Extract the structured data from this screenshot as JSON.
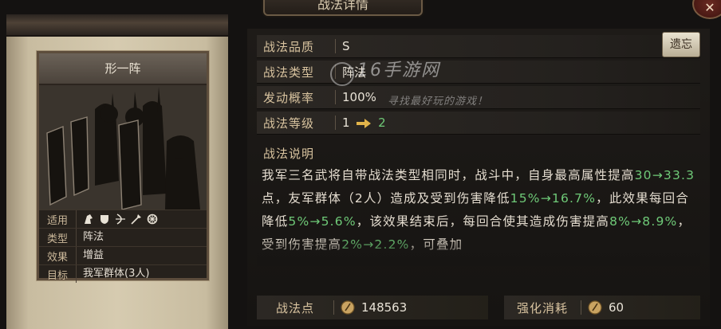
{
  "window": {
    "title": "战法详情",
    "close_label": "✕"
  },
  "card": {
    "name": "形一阵",
    "rows": [
      {
        "key": "适用",
        "type": "weapons",
        "icons": [
          "cavalry-icon",
          "shield-icon",
          "bow-icon",
          "spear-icon",
          "wheel-icon"
        ]
      },
      {
        "key": "类型",
        "value": "阵法"
      },
      {
        "key": "效果",
        "value": "增益"
      },
      {
        "key": "目标",
        "value": "我军群体(3人)"
      }
    ]
  },
  "details": {
    "quality_label": "战法品质",
    "quality_value": "S",
    "type_label": "战法类型",
    "type_value": "阵法",
    "trigger_label": "发动概率",
    "trigger_value": "100%",
    "level_label": "战法等级",
    "level_from": "1",
    "level_to": "2",
    "recall_button": "遗忘"
  },
  "description": {
    "heading": "战法说明",
    "segments": [
      {
        "t": "我军三名武将自带战法类型相同时，战斗中，自身最高属性提高",
        "c": "n"
      },
      {
        "t": "30→33.3",
        "c": "g"
      },
      {
        "t": "点，友军群体（2人）造成及受到伤害降低",
        "c": "n"
      },
      {
        "t": "15%→16.7%",
        "c": "g"
      },
      {
        "t": "，此效果每回合降低",
        "c": "n"
      },
      {
        "t": "5%→5.6%",
        "c": "g"
      },
      {
        "t": "，该效果结束后，每回合使其造成伤害提高",
        "c": "n"
      },
      {
        "t": "8%→8.9%",
        "c": "g"
      },
      {
        "t": "，受到伤害提高",
        "c": "n"
      },
      {
        "t": "2%→2.2%",
        "c": "g"
      },
      {
        "t": "，可叠加",
        "c": "n"
      }
    ]
  },
  "footer": {
    "points_label": "战法点",
    "points_value": "148563",
    "cost_label": "强化消耗",
    "cost_value": "60"
  },
  "watermark": {
    "brand": "16手游网",
    "slogan": "寻找最好玩的游戏！"
  },
  "colors": {
    "accent_gold": "#d8c39f",
    "upgrade_green": "#6fca78",
    "arrow_gold": "#e2b44a"
  }
}
